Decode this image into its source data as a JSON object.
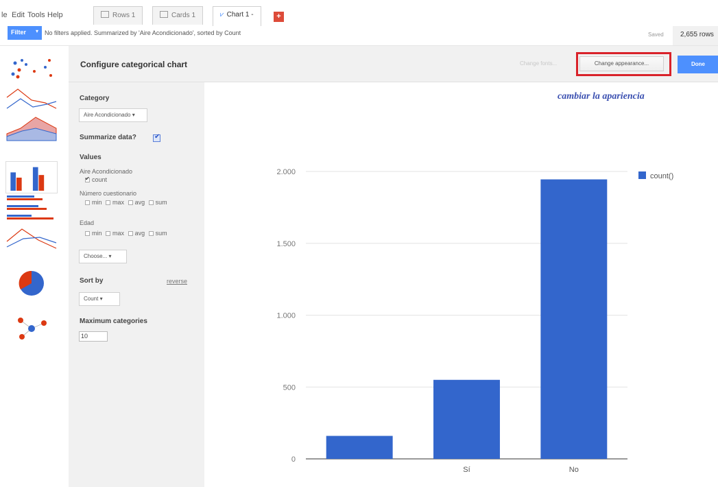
{
  "menu": [
    "le",
    "Edit",
    "Tools",
    "Help"
  ],
  "tabs": [
    {
      "label": "Rows 1"
    },
    {
      "label": "Cards 1"
    },
    {
      "label": "Chart 1 -"
    }
  ],
  "add_tab_label": "+",
  "filter_bar": {
    "filter_label": "Filter",
    "caret": "▾",
    "summary": "No filters applied. Summarized by 'Aire Acondicionado', sorted by Count",
    "saved": "Saved",
    "row_count": "2,655 rows"
  },
  "header": {
    "title": "Configure categorical chart",
    "change_fonts": "Change fonts...",
    "change_appearance": "Change appearance...",
    "done": "Done"
  },
  "panel": {
    "category_label": "Category",
    "category_value": "Aire Acondicionado ▾",
    "summarize_label": "Summarize data?",
    "values_label": "Values",
    "field1": "Aire Acondicionado",
    "field1_option": "count",
    "field2": "Número cuestionario",
    "field3": "Edad",
    "agg_min": "min",
    "agg_max": "max",
    "agg_avg": "avg",
    "agg_sum": "sum",
    "choose": "Choose... ▾",
    "sort_label": "Sort by",
    "reverse": "reverse",
    "sort_value": "Count ▾",
    "max_label": "Maximum categories",
    "max_value": "10"
  },
  "annotation": "cambiar la apariencia",
  "colors": {
    "bar": "#3366cc",
    "accent": "#4d90fe",
    "highlight": "#d9222a"
  },
  "chart_data": {
    "type": "bar",
    "categories": [
      "",
      "Sí",
      "No"
    ],
    "series": [
      {
        "name": "count()",
        "values": [
          160,
          550,
          1945
        ]
      }
    ],
    "yticks": [
      "0",
      "500",
      "1.000",
      "1.500",
      "2.000"
    ],
    "ytick_values": [
      0,
      500,
      1000,
      1500,
      2000
    ],
    "ylim": [
      0,
      2000
    ],
    "legend": "right",
    "grid": true
  }
}
